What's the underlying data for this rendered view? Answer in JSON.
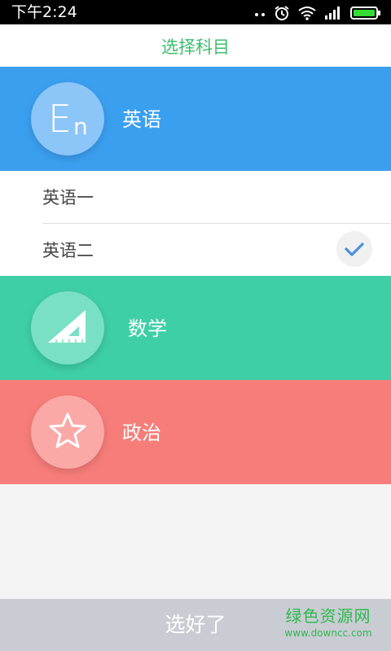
{
  "status_bar": {
    "time": "下午2:24",
    "icons": [
      "signal-dots-icon",
      "alarm-icon",
      "wifi-icon",
      "cell-signal-icon",
      "battery-icon"
    ]
  },
  "header": {
    "title": "选择科目"
  },
  "subjects": [
    {
      "id": "english",
      "label": "英语",
      "icon": "english-en-icon",
      "icon_text_big": "E",
      "icon_text_small": "n",
      "color": "#3b9ff0"
    },
    {
      "id": "math",
      "label": "数学",
      "icon": "triangle-ruler-icon",
      "color": "#3ecfa6"
    },
    {
      "id": "politics",
      "label": "政治",
      "icon": "star-icon",
      "color": "#f77d7a"
    }
  ],
  "english_options": [
    {
      "label": "英语一",
      "selected": false
    },
    {
      "label": "英语二",
      "selected": true
    }
  ],
  "footer": {
    "done_label": "选好了"
  },
  "watermark": {
    "title": "绿色资源网",
    "url": "www.downcc.com"
  },
  "colors": {
    "header_text": "#3dbd6e",
    "check_mark": "#4a8fe0",
    "bottom_bar": "#c9ccd3"
  }
}
